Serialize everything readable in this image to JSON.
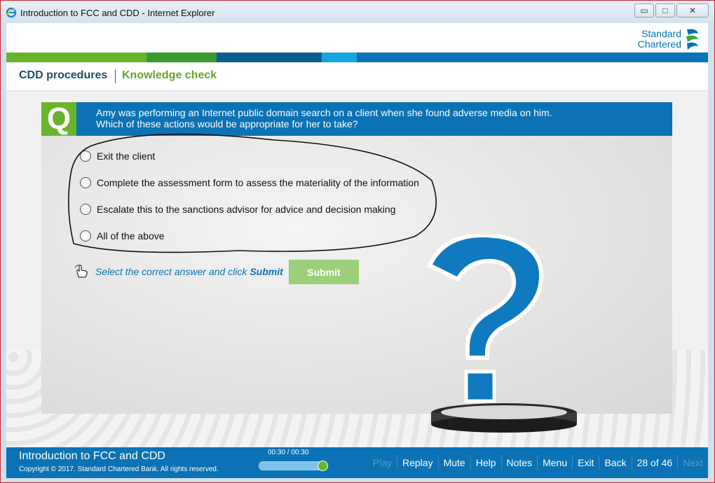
{
  "window": {
    "title": "Introduction to FCC and CDD - Internet Explorer",
    "controls": {
      "minimize": "▭",
      "maximize": "□",
      "close": "✕"
    }
  },
  "brand": {
    "line1": "Standard",
    "line2": "Chartered"
  },
  "breadcrumb": {
    "section": "CDD procedures",
    "page": "Knowledge check"
  },
  "question": {
    "badge": "Q",
    "text_line1": "Amy was performing an Internet public domain search on a client when she found adverse media on him.",
    "text_line2": "Which of these actions would be appropriate for her to take?",
    "options": [
      "Exit the client",
      "Complete the assessment form to assess the materiality of the information",
      "Escalate this to the sanctions advisor for advice and decision making",
      "All of the above"
    ]
  },
  "instruction": {
    "text": "Select the correct answer and click",
    "emphasis": "Submit"
  },
  "submit_label": "Submit",
  "footer": {
    "course_title": "Introduction to FCC and CDD",
    "copyright": "Copyright © 2017. Standard Chartered Bank. All rights reserved.",
    "time": "00:30 / 00:30",
    "progress": 1.0,
    "nav": {
      "play": "Play",
      "replay": "Replay",
      "mute": "Mute",
      "help": "Help",
      "notes": "Notes",
      "menu": "Menu",
      "exit": "Exit",
      "back": "Back",
      "page": "28 of 46",
      "next": "Next"
    }
  },
  "colors": {
    "brand_blue": "#0a72b5",
    "brand_green": "#6ab42d",
    "submit_disabled": "#9ad07a"
  },
  "icons": [
    "ie-icon",
    "standard-chartered-logo-icon",
    "hand-pointer-icon",
    "question-mark-illustration"
  ]
}
